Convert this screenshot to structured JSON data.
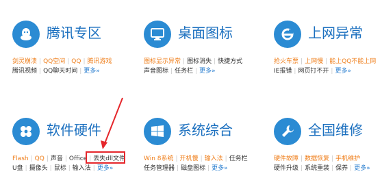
{
  "categories": [
    {
      "title": "腾讯专区",
      "icon": "qq-penguin-icon",
      "rows": [
        [
          {
            "t": "剑灵崩溃",
            "hot": true
          },
          {
            "t": "QQ空间",
            "hot": true
          },
          {
            "t": "QQ",
            "hot": true
          },
          {
            "t": "腾讯游戏",
            "hot": true
          }
        ],
        [
          {
            "t": "腾讯视频"
          },
          {
            "t": "QQ聊天时间"
          },
          {
            "t": "更多»",
            "more": true
          }
        ]
      ]
    },
    {
      "title": "桌面图标",
      "icon": "monitor-icon",
      "rows": [
        [
          {
            "t": "图标显示异常",
            "hot": true
          },
          {
            "t": "图标消失"
          },
          {
            "t": "快捷方式"
          }
        ],
        [
          {
            "t": "声音图标"
          },
          {
            "t": "任务栏"
          },
          {
            "t": "更多»",
            "more": true
          }
        ]
      ]
    },
    {
      "title": "上网异常",
      "icon": "ie-browser-icon",
      "rows": [
        [
          {
            "t": "抢火车票",
            "hot": true
          },
          {
            "t": "上网慢",
            "hot": true
          },
          {
            "t": "能上QQ不能上网",
            "hot": true
          }
        ],
        [
          {
            "t": "IE报错"
          },
          {
            "t": "网页打不开"
          },
          {
            "t": "更多»",
            "more": true
          }
        ]
      ]
    },
    {
      "title": "软件硬件",
      "icon": "usb-icon",
      "rows": [
        [
          {
            "t": "Flash",
            "hot": true
          },
          {
            "t": "QQ",
            "hot": true
          },
          {
            "t": "声音"
          },
          {
            "t": "Office"
          },
          {
            "t": "丢失dll文件"
          }
        ],
        [
          {
            "t": "U盘"
          },
          {
            "t": "摄像头"
          },
          {
            "t": "鼠标"
          },
          {
            "t": "输入法"
          },
          {
            "t": "更多»",
            "more": true
          }
        ]
      ]
    },
    {
      "title": "系统综合",
      "icon": "windows-logo-icon",
      "rows": [
        [
          {
            "t": "Win 8系统",
            "hot": true
          },
          {
            "t": "开机慢",
            "hot": true
          },
          {
            "t": "输入法",
            "hot": true
          },
          {
            "t": "任务栏"
          }
        ],
        [
          {
            "t": "任务管理器"
          },
          {
            "t": "磁盘图标"
          },
          {
            "t": "更多»",
            "more": true
          }
        ]
      ]
    },
    {
      "title": "全国维修",
      "icon": "wrench-icon",
      "rows": [
        [
          {
            "t": "硬件故障",
            "hot": true
          },
          {
            "t": "数据恢复",
            "hot": true
          },
          {
            "t": "手机维护",
            "hot": true
          }
        ],
        [
          {
            "t": "硬件升级"
          },
          {
            "t": "系统重装"
          },
          {
            "t": "保养"
          },
          {
            "t": "更多»",
            "more": true
          }
        ]
      ]
    }
  ]
}
